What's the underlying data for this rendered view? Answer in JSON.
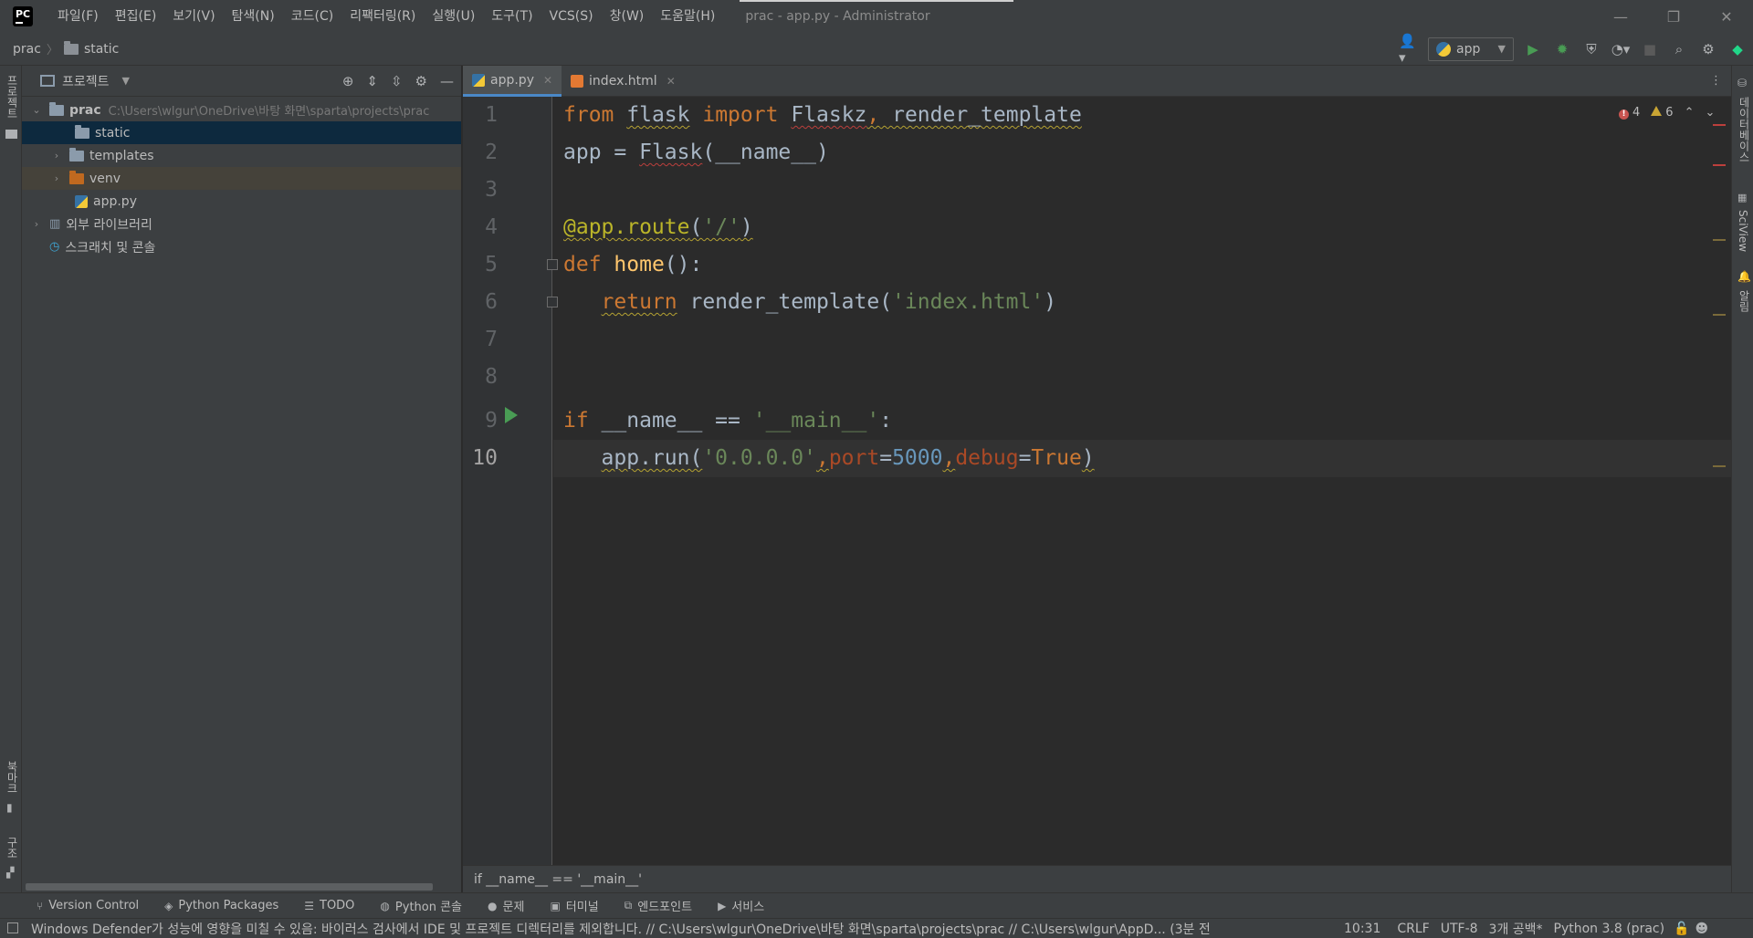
{
  "window": {
    "title": "prac - app.py - Administrator",
    "logo_text": "PC",
    "minimize": "—",
    "restore": "❐",
    "close": "✕"
  },
  "menu": [
    "파일(F)",
    "편집(E)",
    "보기(V)",
    "탐색(N)",
    "코드(C)",
    "리팩터링(R)",
    "실행(U)",
    "도구(T)",
    "VCS(S)",
    "창(W)",
    "도움말(H)"
  ],
  "breadcrumb": {
    "project": "prac",
    "folder": "static"
  },
  "toolbar": {
    "run_config": "app"
  },
  "left_stripe": {
    "project": "프로젝트",
    "bookmarks": "북마크",
    "structure": "구조"
  },
  "right_stripe": {
    "database": "데이터베이스",
    "sciview": "SciView",
    "notifications": "알림"
  },
  "project_panel": {
    "title": "프로젝트",
    "tree": [
      {
        "label": "prac",
        "path": "C:\\Users\\wlgur\\OneDrive\\바탕 화면\\sparta\\projects\\prac"
      },
      {
        "label": "static"
      },
      {
        "label": "templates"
      },
      {
        "label": "venv"
      },
      {
        "label": "app.py"
      },
      {
        "label": "외부 라이브러리"
      },
      {
        "label": "스크래치 및 콘솔"
      }
    ]
  },
  "tabs": [
    {
      "label": "app.py",
      "close": "✕"
    },
    {
      "label": "index.html",
      "close": "✕"
    }
  ],
  "editor": {
    "line_numbers": [
      "1",
      "2",
      "3",
      "4",
      "5",
      "6",
      "7",
      "8",
      "9",
      "10"
    ],
    "code": {
      "l1_from": "from",
      "l1_flask": "flask",
      "l1_import": "import",
      "l1_flaskz": "Flaskz",
      "l1_comma": ",",
      "l1_rt": " render_template",
      "l2": "app = ",
      "l2_flask": "Flask",
      "l2_rest": "(__name__)",
      "l4_dec": "@app.route",
      "l4_open": "(",
      "l4_str": "'/'",
      "l4_close": ")",
      "l5_def": "def",
      "l5_fn": "home",
      "l5_rest": "():",
      "l6_ret": "return",
      "l6_call": " render_template(",
      "l6_str": "'index.html'",
      "l6_close": ")",
      "l9_if": "if",
      "l9_mid": " __name__ == ",
      "l9_str": "'__main__'",
      "l9_colon": ":",
      "l10_call": "app.run(",
      "l10_str": "'0.0.0.0'",
      "l10_c1": ",",
      "l10_port": "port",
      "l10_eq1": "=",
      "l10_num": "5000",
      "l10_c2": ",",
      "l10_debug": "debug",
      "l10_eq2": "=",
      "l10_true": "True",
      "l10_close": ")"
    },
    "errors": "4",
    "warnings": "6"
  },
  "editor_breadcrumb": "if __name__ == '__main__'",
  "tool_windows": [
    "Version Control",
    "Python Packages",
    "TODO",
    "Python 콘솔",
    "문제",
    "터미널",
    "엔드포인트",
    "서비스"
  ],
  "status": {
    "message": "Windows Defender가 성능에 영향을 미칠 수 있음: 바이러스 검사에서 IDE 및 프로젝트 디렉터리를 제외합니다. // C:\\Users\\wlgur\\OneDrive\\바탕 화면\\sparta\\projects\\prac // C:\\Users\\wlgur\\AppD... (3분 전",
    "position": "10:31",
    "line_sep": "CRLF",
    "encoding": "UTF-8",
    "indent": "3개 공백*",
    "interpreter": "Python 3.8 (prac)"
  },
  "colors": {
    "background": "#2b2b2b",
    "panel": "#3c3f41",
    "selection": "#0d293e",
    "keyword": "#cc7832",
    "string": "#6a8759",
    "number": "#6897bb"
  }
}
